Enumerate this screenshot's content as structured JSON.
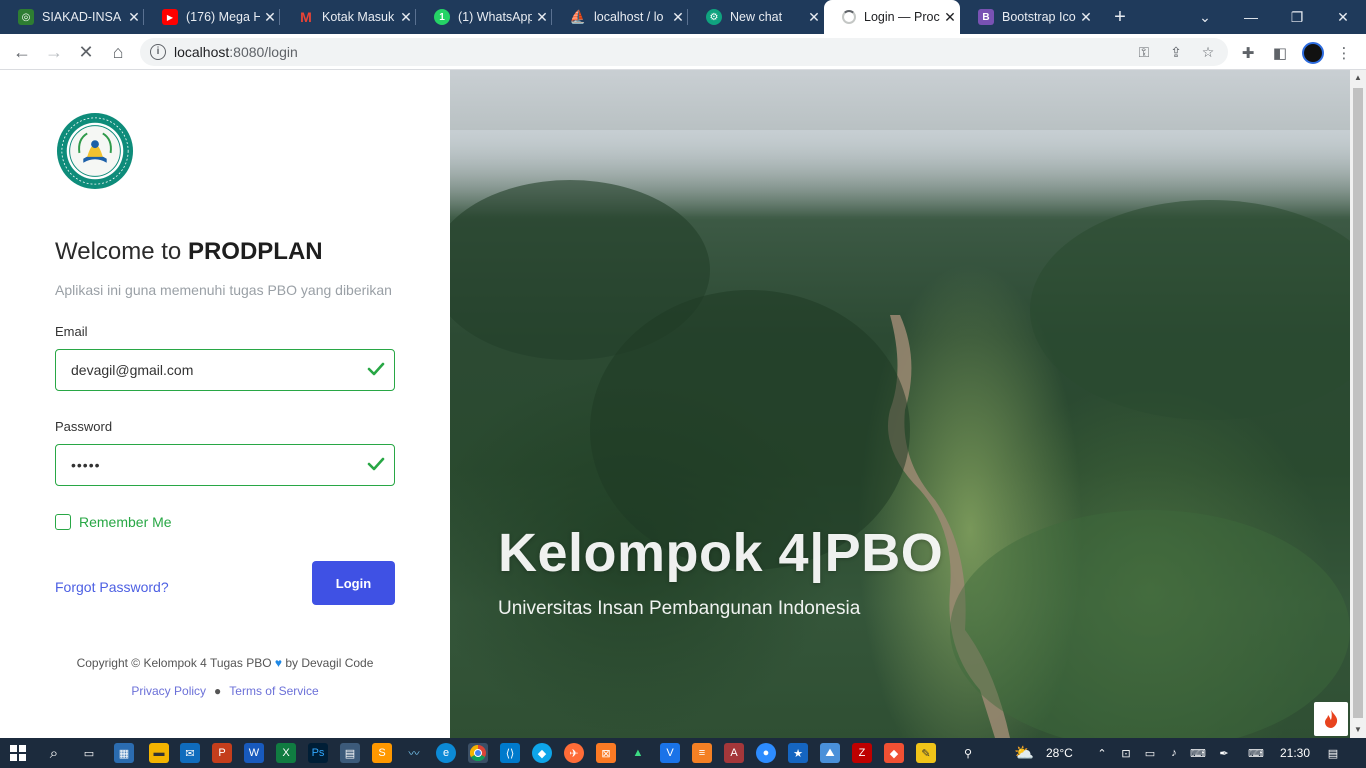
{
  "browser": {
    "tabs": [
      {
        "title": "SIAKAD-INSA",
        "favicon_color": "#2e7d32",
        "favicon_glyph": "◎",
        "icon": "siakad-icon"
      },
      {
        "title": "(176) Mega H",
        "favicon_color": "#ff0000",
        "favicon_glyph": "▶",
        "icon": "youtube-icon"
      },
      {
        "title": "Kotak Masuk",
        "favicon_color": "#ea4335",
        "favicon_glyph": "M",
        "icon": "gmail-icon"
      },
      {
        "title": "(1) WhatsApp",
        "favicon_color": "#25d366",
        "favicon_glyph": "1",
        "icon": "whatsapp-icon"
      },
      {
        "title": "localhost / lo",
        "favicon_color": "#f89c0e",
        "favicon_glyph": "⛵",
        "icon": "phpmyadmin-icon"
      },
      {
        "title": "New chat",
        "favicon_color": "#10a37f",
        "favicon_glyph": "⚙",
        "icon": "chatgpt-icon"
      },
      {
        "title": "Login — Proc",
        "favicon_color": "#ffffff",
        "favicon_glyph": "◌",
        "icon": "loading-icon"
      },
      {
        "title": "Bootstrap Ico",
        "favicon_color": "#7952b3",
        "favicon_glyph": "B",
        "icon": "bootstrap-icon"
      }
    ],
    "active_tab_index": 6,
    "address": {
      "host": "localhost",
      "path": ":8080/login"
    }
  },
  "page": {
    "welcome_prefix": "Welcome to ",
    "app_name": "PRODPLAN",
    "subtitle": "Aplikasi ini guna memenuhi tugas PBO yang diberikan",
    "email_label": "Email",
    "email_value": "devagil@gmail.com",
    "password_label": "Password",
    "password_value": "•••••",
    "remember_label": "Remember Me",
    "forgot_label": "Forgot Password?",
    "login_label": "Login",
    "copyright_prefix": "Copyright © Kelompok 4 Tugas PBO",
    "copyright_suffix": " by Devagil Code",
    "privacy_label": "Privacy Policy",
    "terms_label": "Terms of Service",
    "hero_title": "Kelompok 4|PBO",
    "hero_subtitle": "Universitas Insan Pembangunan Indonesia",
    "colors": {
      "valid": "#28a745",
      "primary": "#3f51e4",
      "link": "#4c5fe3"
    }
  },
  "taskbar": {
    "weather": "28°C",
    "time": "21:30",
    "icons": [
      "windows-start-icon",
      "search-icon",
      "task-view-icon",
      "store-icon",
      "file-explorer-icon",
      "mail-icon",
      "powerpoint-icon",
      "word-icon",
      "excel-icon",
      "photoshop-icon",
      "app-icon",
      "sublime-icon",
      "wave-icon",
      "edge-icon",
      "chrome-icon",
      "vscode-icon",
      "app-icon",
      "postman-icon",
      "xampp-icon",
      "virtualbox-icon",
      "stack-icon",
      "stack-icon",
      "access-icon",
      "android-studio-icon",
      "zoom-icon",
      "star-icon",
      "app-icon",
      "filezilla-icon",
      "git-icon",
      "notepad-icon",
      "people-icon"
    ]
  }
}
